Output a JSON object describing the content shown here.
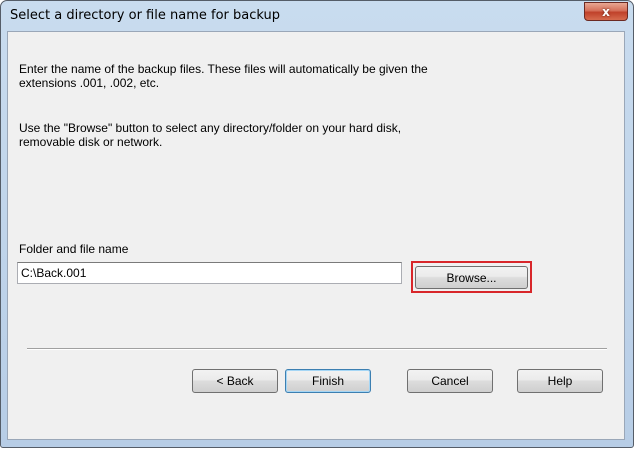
{
  "window": {
    "title": "Select a directory or file name for backup",
    "close_glyph": "x"
  },
  "instructions": {
    "paragraph1": "Enter the name of the backup files. These files will automatically be given the\nextensions .001, .002, etc.",
    "paragraph2": "Use the \"Browse\" button to select any directory/folder on your hard disk,\nremovable disk or network."
  },
  "path_field": {
    "label": "Folder and file name",
    "value": "C:\\Back.001",
    "browse_label": "Browse...",
    "highlight_color": "#d8262a"
  },
  "footer": {
    "back_label": "< Back",
    "finish_label": "Finish",
    "cancel_label": "Cancel",
    "help_label": "Help"
  }
}
